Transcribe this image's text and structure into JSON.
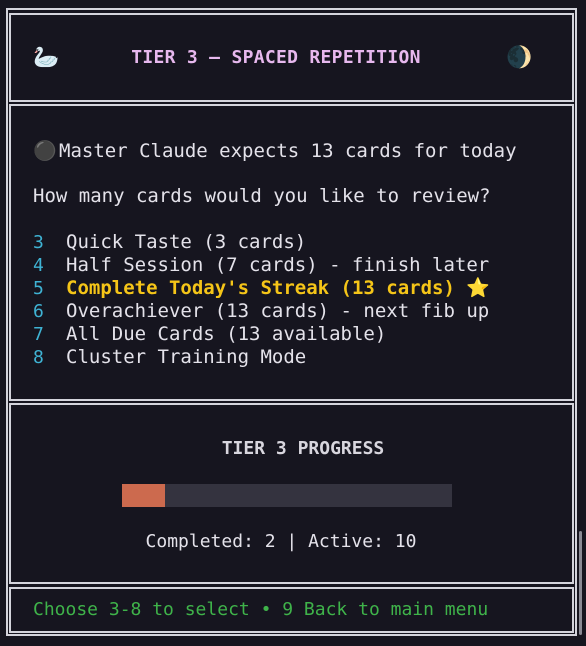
{
  "header": {
    "left_icon": "🦢",
    "left_icon_name": "swan-icon",
    "title": "TIER 3 — SPACED REPETITION",
    "right_icon": "🌒",
    "right_icon_name": "moon-icon"
  },
  "menu": {
    "expect_icon": "⚫",
    "expect_text": "Master Claude expects 13 cards for today",
    "prompt": "How many cards would you like to review?",
    "options": [
      {
        "number": "3",
        "label": "Quick Taste (3 cards)"
      },
      {
        "number": "4",
        "label": "Half Session (7 cards) - finish later"
      },
      {
        "number": "5",
        "label": "Complete Today's Streak (13 cards) ⭐",
        "highlighted": true
      },
      {
        "number": "6",
        "label": "Overachiever (13 cards) - next fib up"
      },
      {
        "number": "7",
        "label": "All Due Cards (13 available)"
      },
      {
        "number": "8",
        "label": "Cluster Training Mode"
      }
    ]
  },
  "progress": {
    "title": "TIER 3 PROGRESS",
    "fill_fraction": 0.13,
    "stats": "Completed: 2 | Active: 10"
  },
  "footer": {
    "text": "Choose 3-8 to select • 9 Back to main menu"
  },
  "colors": {
    "background": "#16151f",
    "title": "#e7b8ee",
    "option_number": "#3fb3d4",
    "highlight": "#f5c518",
    "progress_fill": "#cc6a4e",
    "progress_track": "#34333f",
    "footer": "#3fb34a"
  }
}
